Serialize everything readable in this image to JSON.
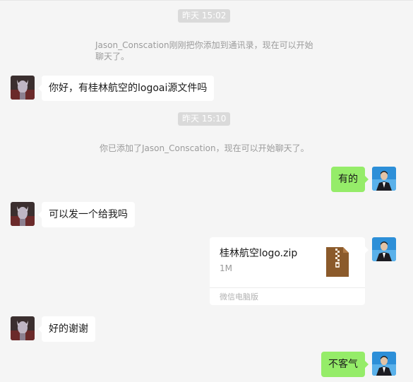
{
  "messages": {
    "time1": "昨天 15:02",
    "sys1_line1": "Jason_Conscation刚刚把你添加到通讯录，现在可以开始",
    "sys1_line2": "聊天了。",
    "msg1": "你好，有桂林航空的logoai源文件吗",
    "time2": "昨天 15:10",
    "sys2": "你已添加了Jason_Conscation，现在可以开始聊天了。",
    "msg2": "有的",
    "msg3": "可以发一个给我吗",
    "file": {
      "name": "桂林航空logo.zip",
      "size": "1M",
      "source": "微信电脑版",
      "icon": "zip-file-icon"
    },
    "msg4": "好的谢谢",
    "msg5": "不客气"
  },
  "colors": {
    "outgoing_bubble": "#95ec69",
    "incoming_bubble": "#ffffff",
    "background": "#f5f5f5",
    "zip_icon": "#8b5a2b"
  }
}
